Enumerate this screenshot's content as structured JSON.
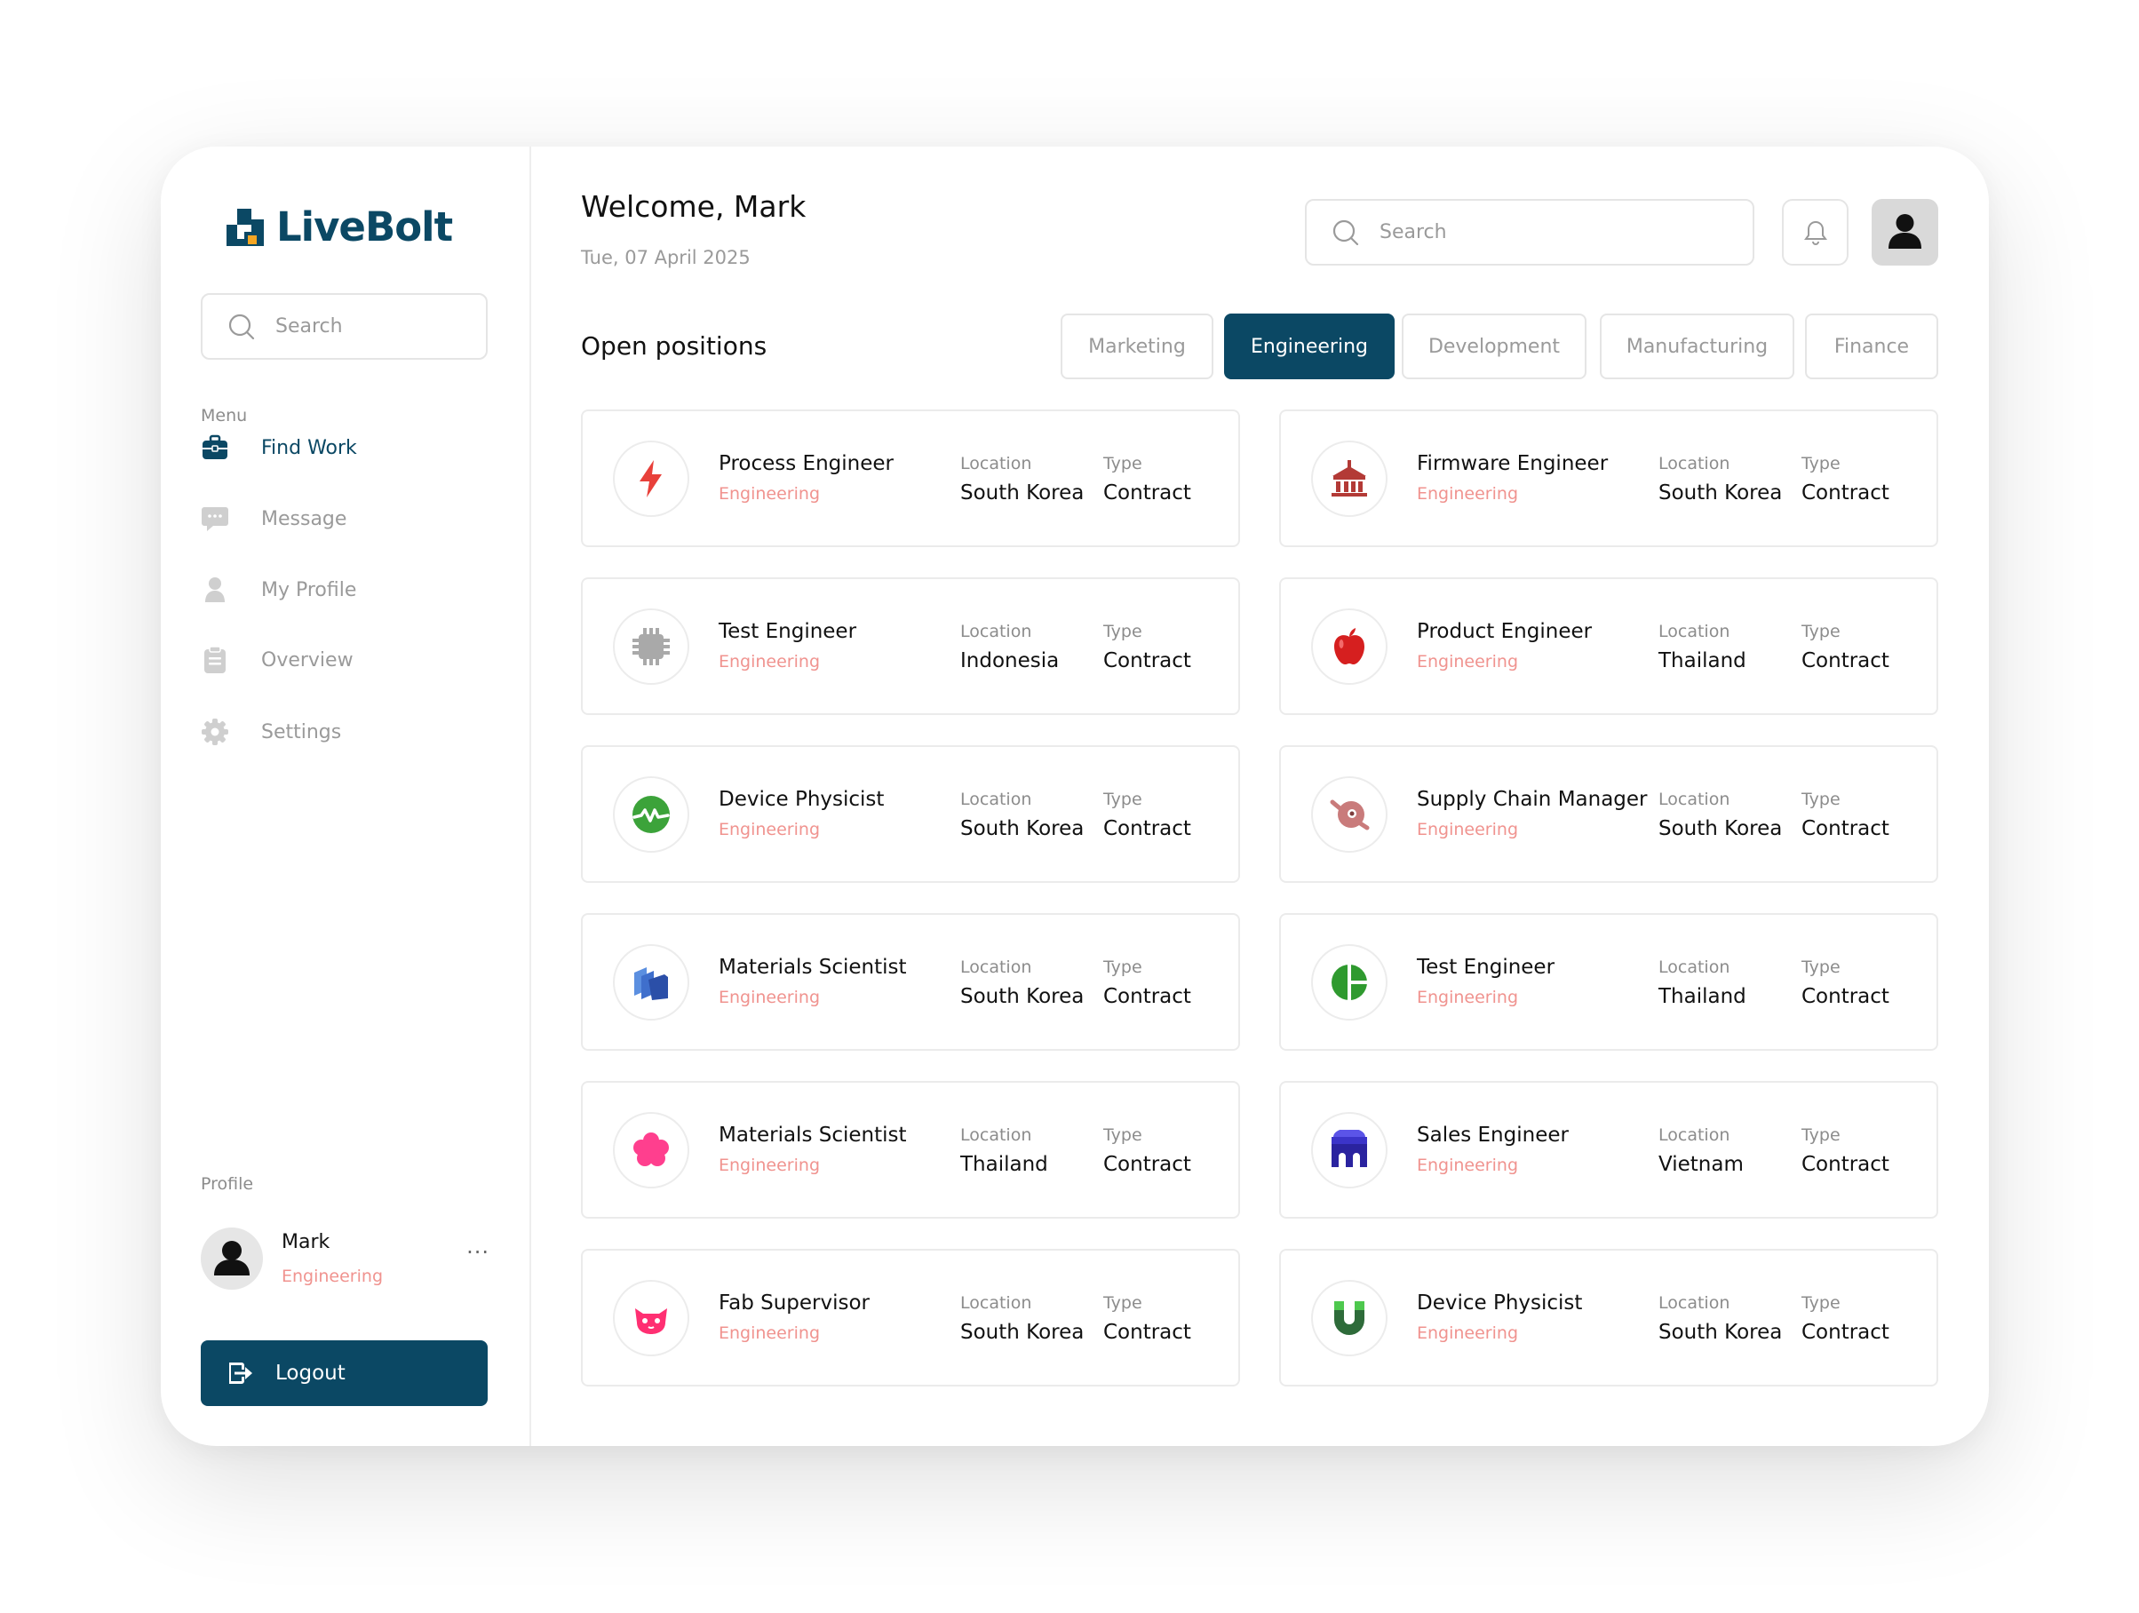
{
  "brand": {
    "name": "LiveBolt",
    "color": "#0b4864"
  },
  "sidebar": {
    "search_placeholder": "Search",
    "menu_label": "Menu",
    "items": [
      {
        "label": "Find Work",
        "icon": "briefcase-icon",
        "active": true
      },
      {
        "label": "Message",
        "icon": "chat-icon",
        "active": false
      },
      {
        "label": "My Profile",
        "icon": "user-icon",
        "active": false
      },
      {
        "label": "Overview",
        "icon": "clipboard-icon",
        "active": false
      },
      {
        "label": "Settings",
        "icon": "gear-icon",
        "active": false
      }
    ],
    "profile_label": "Profile",
    "profile": {
      "name": "Mark",
      "role": "Engineering",
      "more": "···"
    },
    "logout_label": "Logout"
  },
  "header": {
    "welcome": "Welcome, Mark",
    "date": "Tue, 07 April 2025",
    "search_placeholder": "Search"
  },
  "positions": {
    "title": "Open positions",
    "tabs": [
      {
        "label": "Marketing",
        "active": false
      },
      {
        "label": "Engineering",
        "active": true
      },
      {
        "label": "Development",
        "active": false
      },
      {
        "label": "Manufacturing",
        "active": false
      },
      {
        "label": "Finance",
        "active": false
      }
    ],
    "location_label": "Location",
    "type_label": "Type",
    "jobs": [
      {
        "title": "Process Engineer",
        "dept": "Engineering",
        "location": "South Korea",
        "type": "Contract",
        "icon": "lightning-bolt-icon"
      },
      {
        "title": "Firmware Engineer",
        "dept": "Engineering",
        "location": "South Korea",
        "type": "Contract",
        "icon": "bank-building-icon"
      },
      {
        "title": "Test Engineer",
        "dept": "Engineering",
        "location": "Indonesia",
        "type": "Contract",
        "icon": "chip-icon"
      },
      {
        "title": "Product Engineer",
        "dept": "Engineering",
        "location": "Thailand",
        "type": "Contract",
        "icon": "apple-icon"
      },
      {
        "title": "Device Physicist",
        "dept": "Engineering",
        "location": "South Korea",
        "type": "Contract",
        "icon": "pulse-globe-icon"
      },
      {
        "title": "Supply Chain Manager",
        "dept": "Engineering",
        "location": "South Korea",
        "type": "Contract",
        "icon": "planet-icon"
      },
      {
        "title": "Materials Scientist",
        "dept": "Engineering",
        "location": "South Korea",
        "type": "Contract",
        "icon": "stacked-layers-icon"
      },
      {
        "title": "Test Engineer",
        "dept": "Engineering",
        "location": "Thailand",
        "type": "Contract",
        "icon": "split-circle-icon"
      },
      {
        "title": "Materials Scientist",
        "dept": "Engineering",
        "location": "Thailand",
        "type": "Contract",
        "icon": "flower-icon"
      },
      {
        "title": "Sales Engineer",
        "dept": "Engineering",
        "location": "Vietnam",
        "type": "Contract",
        "icon": "arches-icon"
      },
      {
        "title": "Fab Supervisor",
        "dept": "Engineering",
        "location": "South Korea",
        "type": "Contract",
        "icon": "cat-face-icon"
      },
      {
        "title": "Device Physicist",
        "dept": "Engineering",
        "location": "South Korea",
        "type": "Contract",
        "icon": "magnet-icon"
      }
    ]
  },
  "colors": {
    "accent": "#0b4864",
    "department": "#f0938f",
    "muted": "#9a9a9a"
  }
}
